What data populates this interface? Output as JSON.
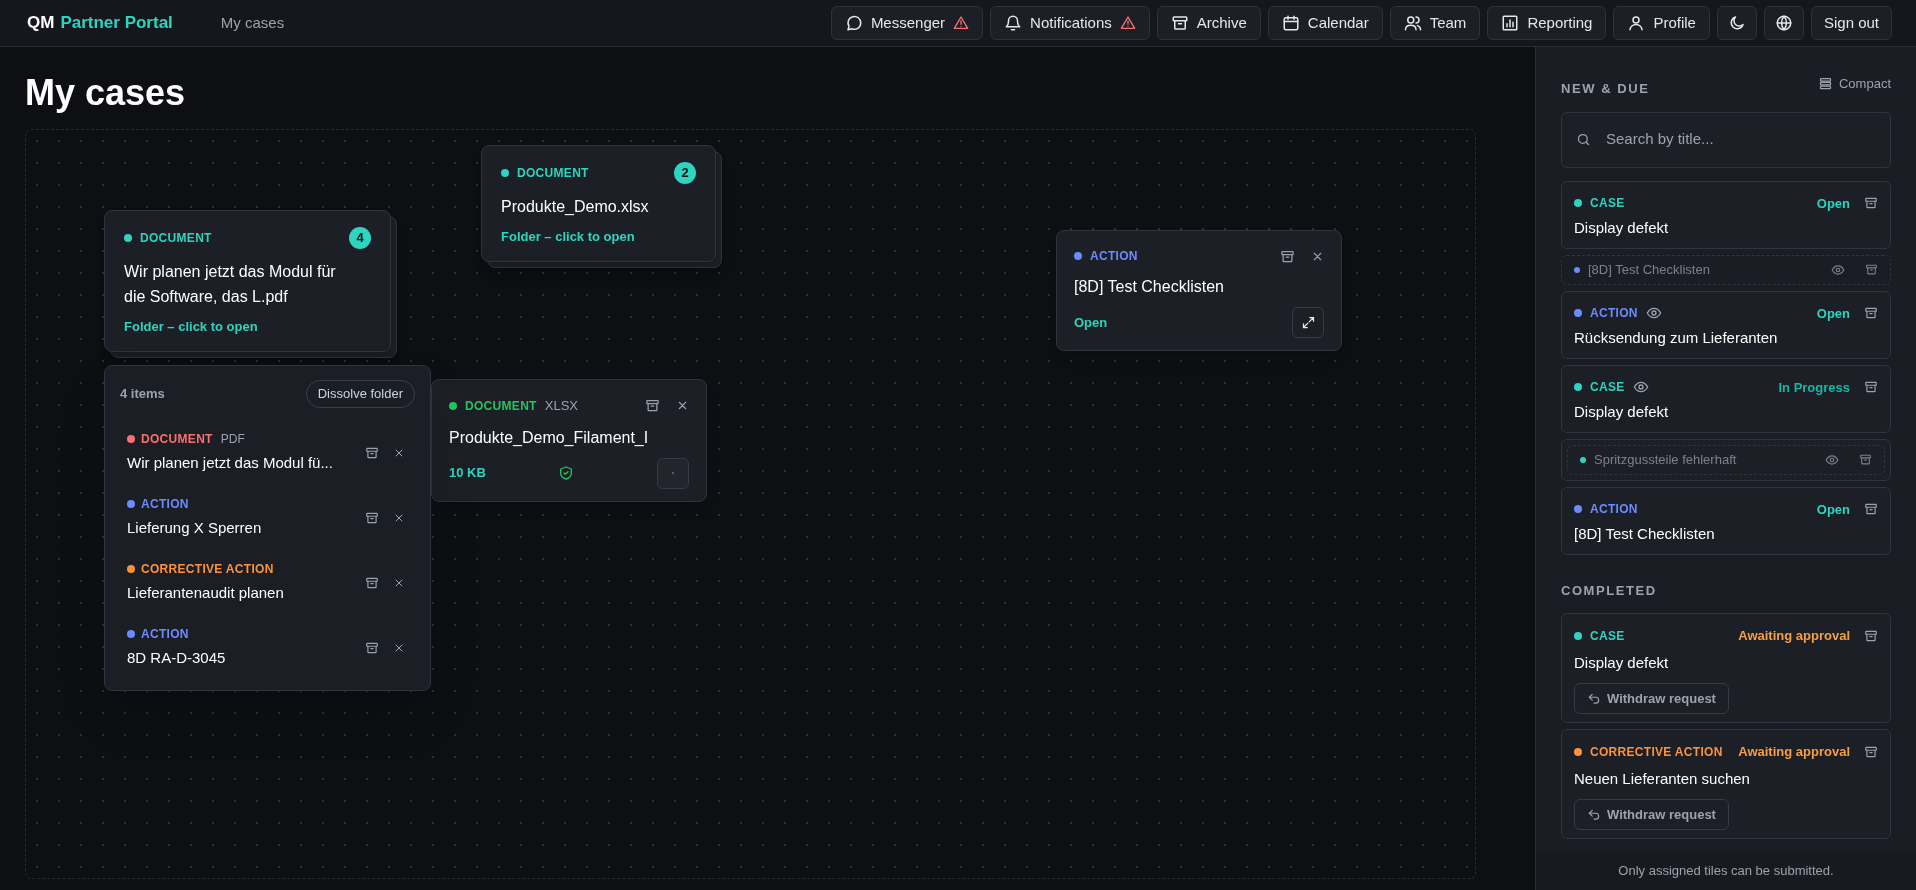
{
  "header": {
    "brand_prefix": "QM",
    "brand_name": "Partner Portal",
    "breadcrumb": "My cases",
    "nav": [
      {
        "label": "Messenger",
        "alert": true
      },
      {
        "label": "Notifications",
        "alert": true
      },
      {
        "label": "Archive",
        "alert": false
      },
      {
        "label": "Calendar",
        "alert": false
      },
      {
        "label": "Team",
        "alert": false
      },
      {
        "label": "Reporting",
        "alert": false
      },
      {
        "label": "Profile",
        "alert": false
      }
    ],
    "sign_out": "Sign out"
  },
  "page_title": "My cases",
  "canvas": {
    "tiles": [
      {
        "kind": "folder",
        "type": "DOCUMENT",
        "color": "#2dd4bf",
        "title": "Wir planen jetzt das Modul für die Software, das L.pdf",
        "count": "4",
        "link": "Folder – click to open"
      },
      {
        "kind": "folder",
        "type": "DOCUMENT",
        "color": "#2dd4bf",
        "title": "Produkte_Demo.xlsx",
        "count": "2",
        "link": "Folder – click to open"
      },
      {
        "kind": "action",
        "type": "ACTION",
        "color": "#6b8cff",
        "title": "[8D] Test Checklisten",
        "status": "Open"
      },
      {
        "kind": "document",
        "type": "DOCUMENT",
        "color": "#22c55e",
        "ext": "XLSX",
        "title": "Produkte_Demo_Filament_I",
        "size": "10 KB"
      }
    ],
    "open_folder": {
      "count": "4 items",
      "dissolve": "Dissolve folder",
      "items": [
        {
          "type": "DOCUMENT",
          "ext": "PDF",
          "color": "#f87171",
          "title": "Wir planen jetzt das Modul fü..."
        },
        {
          "type": "ACTION",
          "color": "#6b8cff",
          "title": "Lieferung X Sperren"
        },
        {
          "type": "CORRECTIVE ACTION",
          "color": "#fb923c",
          "title": "Lieferantenaudit planen"
        },
        {
          "type": "ACTION",
          "color": "#6b8cff",
          "title": "8D RA-D-3045"
        }
      ]
    }
  },
  "sidebar": {
    "new_heading": "NEW & DUE",
    "compact": "Compact",
    "search": {
      "placeholder": "Search by title..."
    },
    "new_items": [
      {
        "kind": "card",
        "type": "CASE",
        "color": "#2dd4bf",
        "watched": false,
        "status": {
          "text": "Open",
          "color": "#2dd4bf"
        },
        "title": "Display defekt"
      },
      {
        "kind": "compact",
        "color": "#6b8cff",
        "title": "[8D] Test Checklisten"
      },
      {
        "kind": "card",
        "type": "ACTION",
        "color": "#6b8cff",
        "watched": true,
        "status": {
          "text": "Open",
          "color": "#2dd4bf"
        },
        "title": "Rücksendung zum Lieferanten"
      },
      {
        "kind": "card",
        "type": "CASE",
        "color": "#2dd4bf",
        "watched": true,
        "status": {
          "text": "In Progress",
          "color": "#14b8a6"
        },
        "title": "Display defekt"
      },
      {
        "kind": "compact_framed",
        "color": "#2dd4bf",
        "title": "Spritzgussteile fehlerhaft"
      },
      {
        "kind": "card",
        "type": "ACTION",
        "color": "#6b8cff",
        "watched": false,
        "status": {
          "text": "Open",
          "color": "#2dd4bf"
        },
        "title": "[8D] Test Checklisten"
      }
    ],
    "completed_heading": "COMPLETED",
    "completed_items": [
      {
        "type": "CASE",
        "color": "#2dd4bf",
        "status": {
          "text": "Awaiting approval",
          "color": "#f59e42"
        },
        "title": "Display defekt",
        "withdraw": "Withdraw request"
      },
      {
        "type": "CORRECTIVE ACTION",
        "color": "#fb923c",
        "status": {
          "text": "Awaiting approval",
          "color": "#f59e42"
        },
        "title": "Neuen Lieferanten suchen",
        "withdraw": "Withdraw request"
      }
    ],
    "footer": "Only assigned tiles can be submitted."
  }
}
